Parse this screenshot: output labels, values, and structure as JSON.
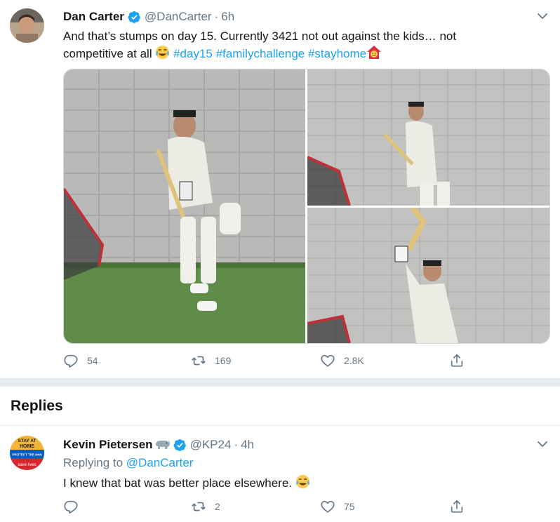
{
  "tweet": {
    "name": "Dan Carter",
    "handle": "@DanCarter",
    "separator": "·",
    "time": "6h",
    "text_line1": "And that’s stumps on day 15. Currently 3421 not out against the kids… not",
    "text_line2_start": "competitive at all ",
    "hashtags": [
      "#day15",
      "#familychallenge",
      "#stayhome"
    ],
    "emoji_laugh": "laughing-crying-emoji",
    "emoji_house": "house-emoji",
    "actions": {
      "replies": "54",
      "retweets": "169",
      "likes": "2.8K"
    }
  },
  "replies_header": "Replies",
  "reply": {
    "name": "Kevin Pietersen",
    "handle": "@KP24",
    "separator": "·",
    "time": "4h",
    "replying_prefix": "Replying to ",
    "replying_to": "@DanCarter",
    "text": "I knew that bat was better place elsewhere. ",
    "avatar_badge_lines": [
      "STAY AT",
      "HOME",
      "PROTECT THE NHS",
      "save lives"
    ],
    "actions": {
      "replies": "",
      "retweets": "2",
      "likes": "75"
    }
  },
  "colors": {
    "accent": "#1da1f2",
    "muted": "#657786",
    "text": "#14171a",
    "separator": "#e6ecf0"
  },
  "icons": [
    "verified-badge-icon",
    "chevron-down-icon",
    "reply-icon",
    "retweet-icon",
    "like-icon",
    "share-icon",
    "rhino-emoji"
  ]
}
